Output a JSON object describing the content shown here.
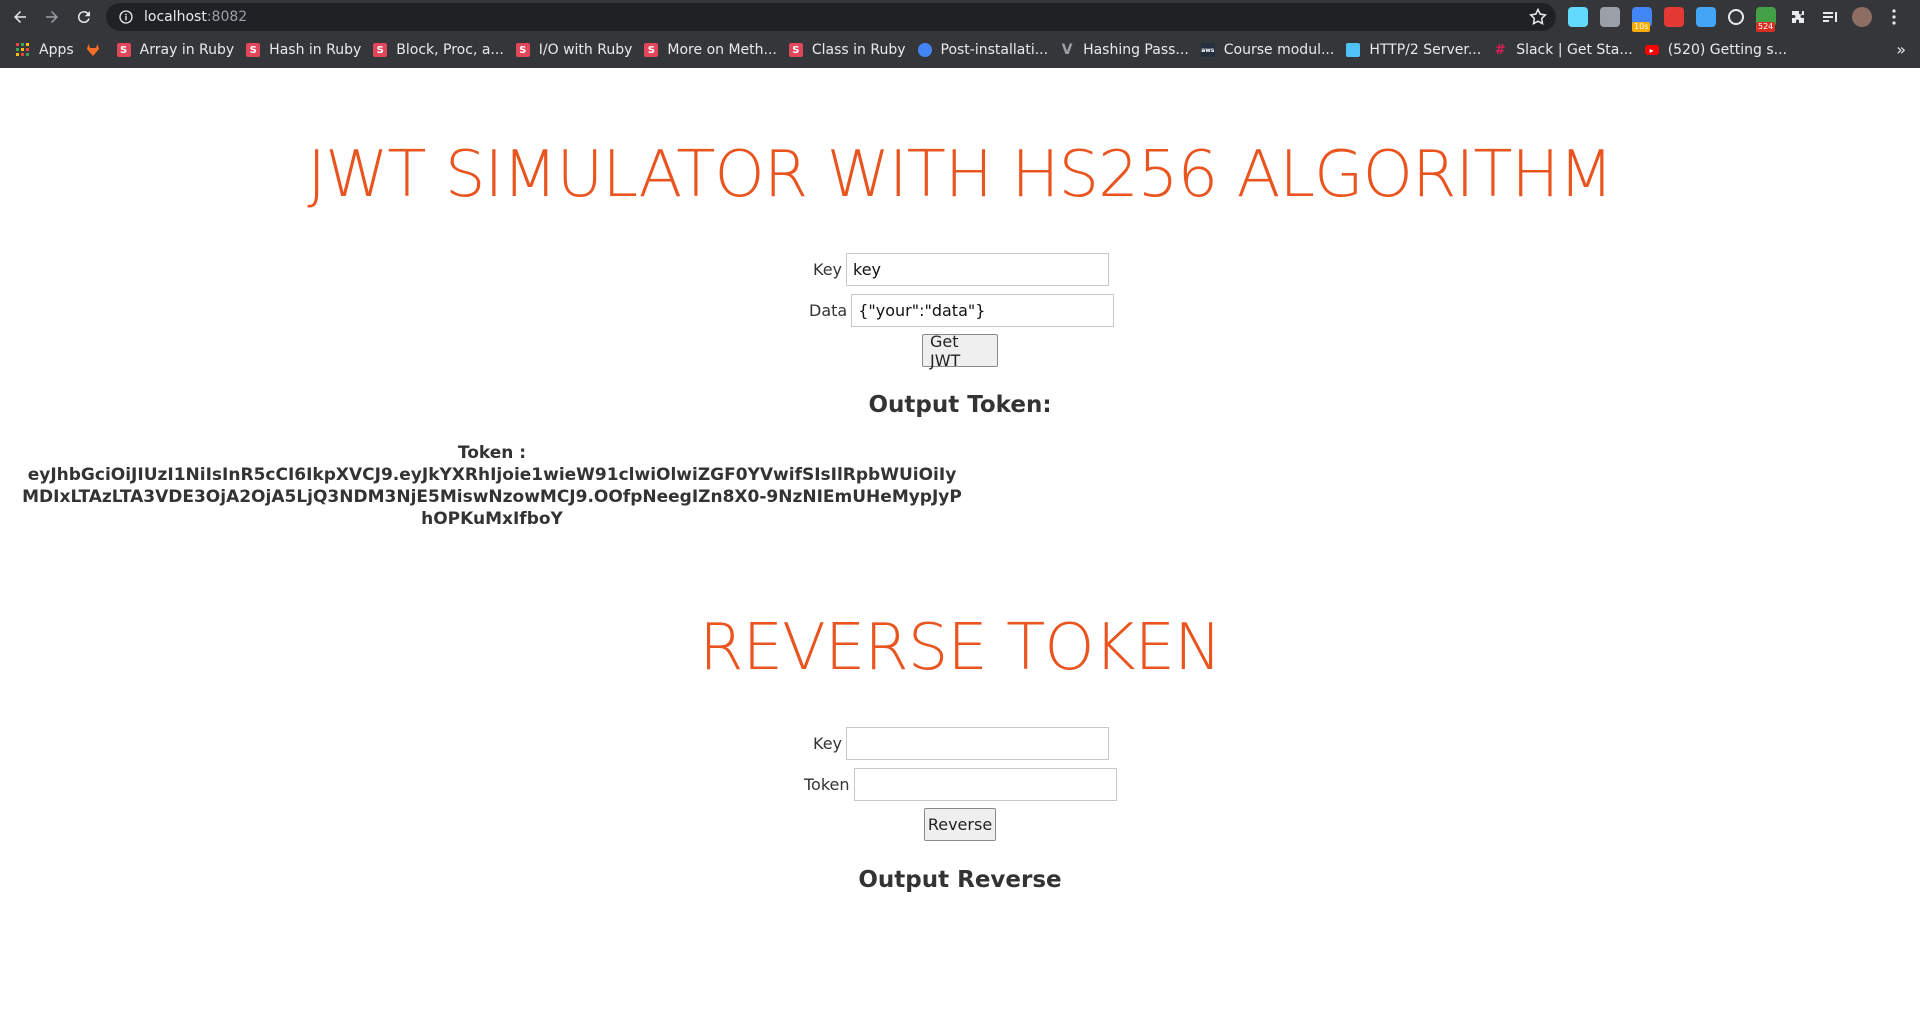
{
  "browser": {
    "url_host": "localhost",
    "url_port": ":8082",
    "bookmarks": [
      {
        "label": "Apps",
        "icon": "apps-grid-icon",
        "color": "#e8eaed"
      },
      {
        "label": "",
        "icon": "gitlab-icon",
        "color": "#fc6d26"
      },
      {
        "label": "Array in Ruby",
        "icon": "s-favicon",
        "color": "#e0475b"
      },
      {
        "label": "Hash in Ruby",
        "icon": "s-favicon",
        "color": "#e0475b"
      },
      {
        "label": "Block, Proc, a...",
        "icon": "s-favicon",
        "color": "#e0475b"
      },
      {
        "label": "I/O with Ruby",
        "icon": "s-favicon",
        "color": "#e0475b"
      },
      {
        "label": "More on Meth...",
        "icon": "s-favicon",
        "color": "#e0475b"
      },
      {
        "label": "Class in Ruby",
        "icon": "s-favicon",
        "color": "#e0475b"
      },
      {
        "label": "Post-installati...",
        "icon": "globe-favicon",
        "color": "#4285f4"
      },
      {
        "label": "Hashing Pass...",
        "icon": "v-favicon",
        "color": "#9aa0a6"
      },
      {
        "label": "Course modul...",
        "icon": "aws-favicon",
        "color": "#232f3e"
      },
      {
        "label": "HTTP/2 Server...",
        "icon": "doc-favicon",
        "color": "#4fc3f7"
      },
      {
        "label": "Slack | Get Sta...",
        "icon": "slack-favicon",
        "color": "#e8eaed"
      },
      {
        "label": "(520) Getting s...",
        "icon": "youtube-favicon",
        "color": "#ff0000"
      }
    ],
    "more_bookmarks": "»",
    "extensions": [
      {
        "name": "react-extension-icon",
        "color": "#61dafb",
        "badge": ""
      },
      {
        "name": "cloud-extension-icon",
        "color": "#9aa0a6",
        "badge": ""
      },
      {
        "name": "calendar-extension-icon",
        "color": "#4285f4",
        "badge": "10s"
      },
      {
        "name": "dice-extension-icon",
        "color": "#e53935",
        "badge": ""
      },
      {
        "name": "plane-extension-icon",
        "color": "#42a5f5",
        "badge": ""
      },
      {
        "name": "w-extension-icon",
        "color": "#e8eaed",
        "badge": ""
      },
      {
        "name": "green-extension-icon",
        "color": "#43a047",
        "badge": "524"
      },
      {
        "name": "puzzle-extension-icon",
        "color": "#e8eaed",
        "badge": ""
      },
      {
        "name": "reading-list-icon",
        "color": "#e8eaed",
        "badge": ""
      },
      {
        "name": "profile-avatar-icon",
        "color": "#8d6e63",
        "badge": ""
      },
      {
        "name": "kebab-menu-icon",
        "color": "#e8eaed",
        "badge": ""
      }
    ]
  },
  "jwt": {
    "title": "JWT SIMULATOR WITH HS256 ALGORITHM",
    "key_label": "Key",
    "key_value": "key",
    "data_label": "Data",
    "data_value": "{\"your\":\"data\"}",
    "button_label": "Get JWT",
    "output_heading": "Output Token:",
    "token_label": "Token :",
    "token_value": "eyJhbGciOiJIUzI1NiIsInR5cCI6IkpXVCJ9.eyJkYXRhIjoie1wieW91clwiOlwiZGF0YVwifSIsIlRpbWUiOiIyMDIxLTAzLTA3VDE3OjA2OjA5LjQ3NDM3NjE5MiswNzowMCJ9.OOfpNeegIZn8X0-9NzNIEmUHeMypJyPhOPKuMxIfboY"
  },
  "reverse": {
    "title": "REVERSE TOKEN",
    "key_label": "Key",
    "key_value": "",
    "token_label": "Token",
    "token_value": "",
    "button_label": "Reverse",
    "output_heading": "Output Reverse"
  }
}
